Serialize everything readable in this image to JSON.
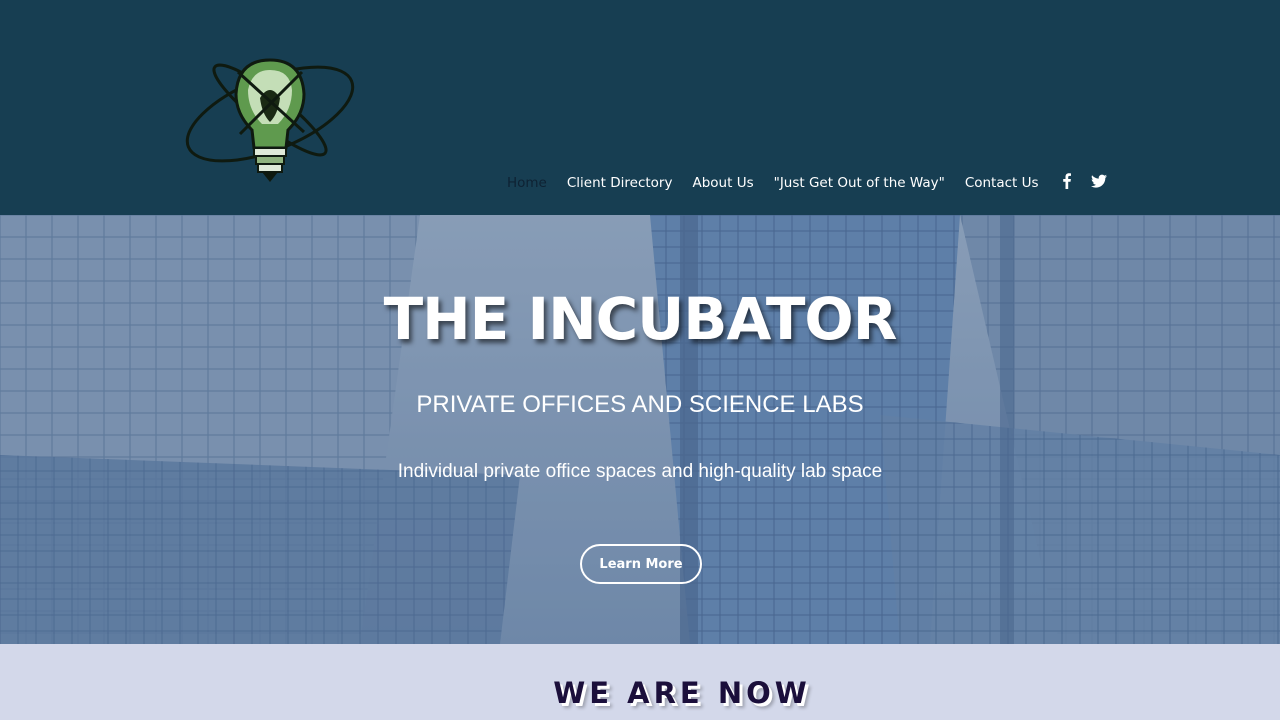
{
  "nav": {
    "items": [
      {
        "label": "Home",
        "active": true
      },
      {
        "label": "Client Directory",
        "active": false
      },
      {
        "label": "About Us",
        "active": false
      },
      {
        "label": "\"Just Get Out of the Way\"",
        "active": false
      },
      {
        "label": "Contact Us",
        "active": false
      }
    ]
  },
  "social": {
    "icons": [
      "facebook-icon",
      "twitter-icon"
    ]
  },
  "hero": {
    "title": "THE INCUBATOR",
    "subtitle": "PRIVATE OFFICES AND SCIENCE LABS",
    "description": "Individual private office spaces and high-quality lab space",
    "button_label": "Learn More"
  },
  "section": {
    "heading": "WE ARE NOW"
  },
  "colors": {
    "header_bg": "#173e52",
    "page_bg": "#d3d8ea",
    "heading_color": "#1b0f3b",
    "nav_active": "#0e2233"
  }
}
